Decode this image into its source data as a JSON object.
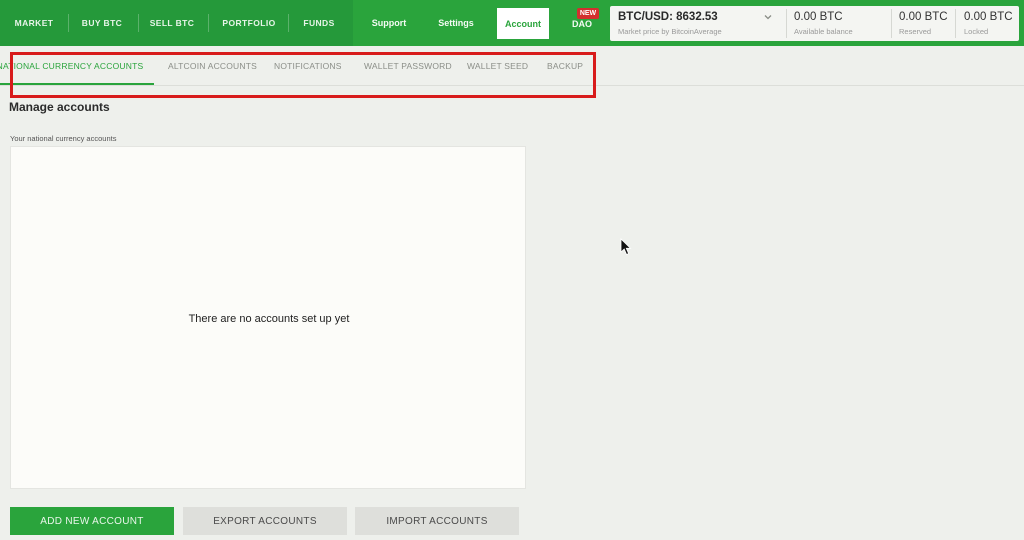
{
  "topnav": {
    "items": [
      {
        "label": "MARKET"
      },
      {
        "label": "BUY BTC"
      },
      {
        "label": "SELL BTC"
      },
      {
        "label": "PORTFOLIO"
      },
      {
        "label": "FUNDS"
      },
      {
        "label": "Support"
      },
      {
        "label": "Settings"
      }
    ],
    "account_label": "Account",
    "dao_label": "DAO",
    "new_badge": "NEW"
  },
  "balances": {
    "price_value": "BTC/USD: 8632.53",
    "price_label": "Market price by BitcoinAverage",
    "available_value": "0.00 BTC",
    "available_label": "Available balance",
    "reserved_value": "0.00 BTC",
    "reserved_label": "Reserved",
    "locked_value": "0.00 BTC",
    "locked_label": "Locked"
  },
  "subnav": {
    "tabs": [
      {
        "label": "NATIONAL CURRENCY ACCOUNTS"
      },
      {
        "label": "ALTCOIN ACCOUNTS"
      },
      {
        "label": "NOTIFICATIONS"
      },
      {
        "label": "WALLET PASSWORD"
      },
      {
        "label": "WALLET SEED"
      },
      {
        "label": "BACKUP"
      }
    ]
  },
  "main": {
    "title": "Manage accounts",
    "section_label": "Your national currency accounts",
    "empty_message": "There are no accounts set up yet",
    "add_button": "ADD NEW ACCOUNT",
    "export_button": "EXPORT ACCOUNTS",
    "import_button": "IMPORT ACCOUNTS"
  },
  "colors": {
    "brand_green": "#2aa43c",
    "highlight_red": "#d81b1b"
  },
  "icons": {
    "dropdown": "chevron-down-icon",
    "cursor": "mouse-pointer-icon"
  }
}
